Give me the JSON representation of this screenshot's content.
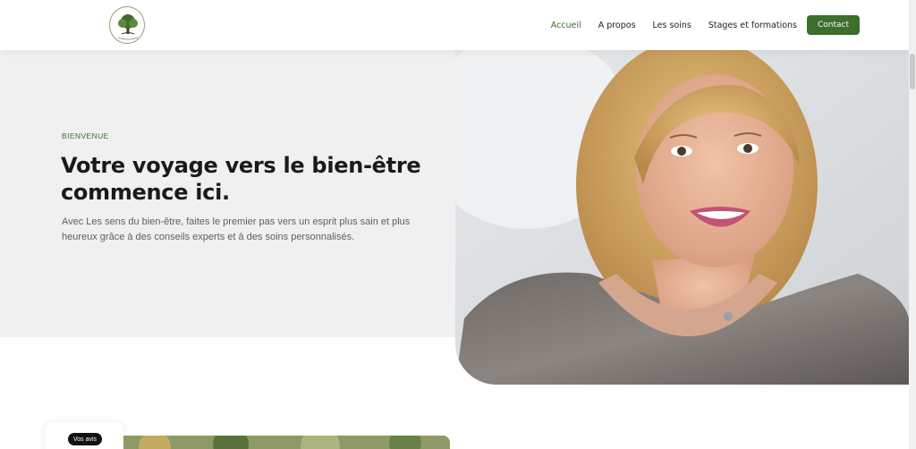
{
  "header": {
    "logo_icon": "tree-of-life-logo-icon",
    "nav": [
      {
        "label": "Accueil",
        "active": true
      },
      {
        "label": "A propos",
        "active": false
      },
      {
        "label": "Les soins",
        "active": false
      },
      {
        "label": "Stages et formations",
        "active": false
      }
    ],
    "contact_label": "Contact"
  },
  "hero": {
    "eyebrow": "BIENVENUE",
    "title": "Votre voyage vers le bien-être commence ici.",
    "text": "Avec Les sens du bien-être, faites le premier pas vers un esprit plus sain et plus heureux grâce à des conseils experts et à des soins personnalisés."
  },
  "reviews": {
    "badge_label": "Vos avis"
  },
  "colors": {
    "accent_green": "#3c6e2e",
    "hero_background": "#f0f0f0"
  }
}
